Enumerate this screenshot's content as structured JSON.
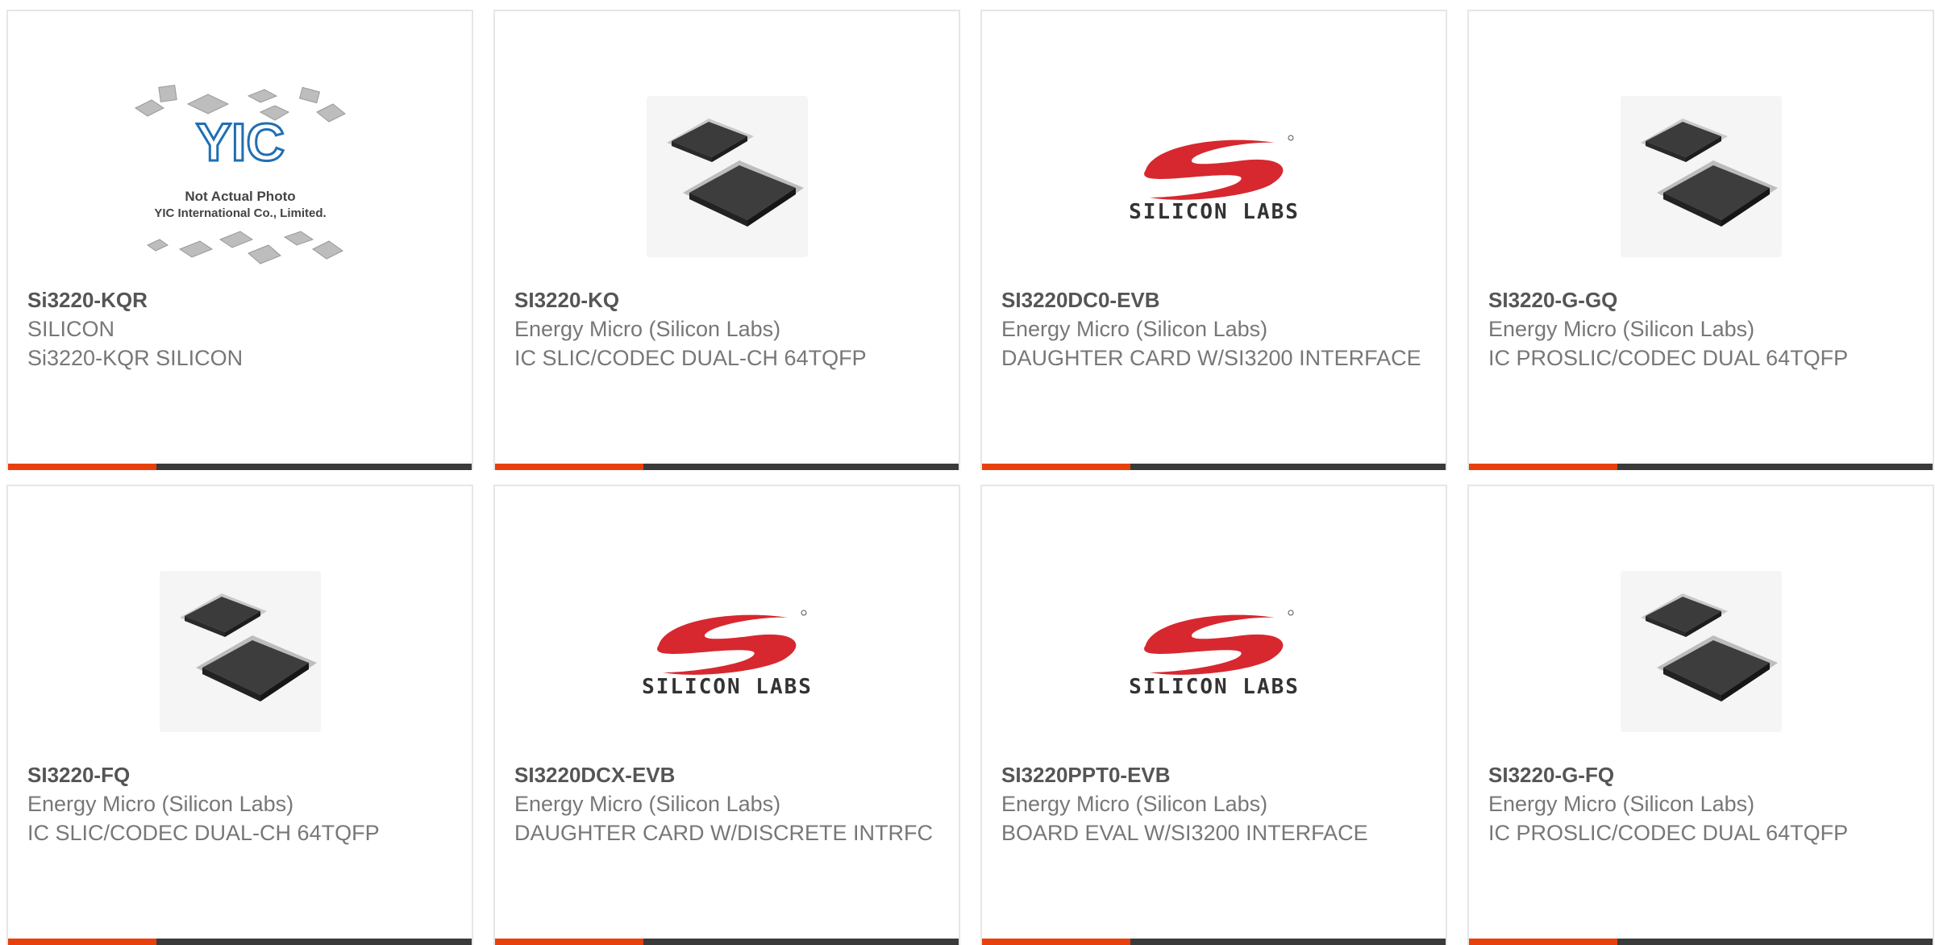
{
  "products": [
    {
      "part": "Si3220-KQR",
      "manufacturer": "SILICON",
      "description": "Si3220-KQR SILICON",
      "image": "not-actual-photo",
      "placeholder": {
        "line1": "Not Actual Photo",
        "line2": "YIC International Co., Limited.",
        "brand": "YIC"
      }
    },
    {
      "part": "SI3220-KQ",
      "manufacturer": "Energy Micro (Silicon Labs)",
      "description": "IC SLIC/CODEC DUAL-CH 64TQFP",
      "image": "chip-photo"
    },
    {
      "part": "SI3220DC0-EVB",
      "manufacturer": "Energy Micro (Silicon Labs)",
      "description": "DAUGHTER CARD W/SI3200 INTERFACE",
      "image": "silicon-labs-logo"
    },
    {
      "part": "SI3220-G-GQ",
      "manufacturer": "Energy Micro (Silicon Labs)",
      "description": "IC PROSLIC/CODEC DUAL 64TQFP",
      "image": "chip-photo"
    },
    {
      "part": "SI3220-FQ",
      "manufacturer": "Energy Micro (Silicon Labs)",
      "description": "IC SLIC/CODEC DUAL-CH 64TQFP",
      "image": "chip-photo"
    },
    {
      "part": "SI3220DCX-EVB",
      "manufacturer": "Energy Micro (Silicon Labs)",
      "description": "DAUGHTER CARD W/DISCRETE INTRFC",
      "image": "silicon-labs-logo"
    },
    {
      "part": "SI3220PPT0-EVB",
      "manufacturer": "Energy Micro (Silicon Labs)",
      "description": "BOARD EVAL W/SI3200 INTERFACE",
      "image": "silicon-labs-logo"
    },
    {
      "part": "SI3220-G-FQ",
      "manufacturer": "Energy Micro (Silicon Labs)",
      "description": "IC PROSLIC/CODEC DUAL 64TQFP",
      "image": "chip-photo"
    }
  ],
  "logo_text": "SILICON LABS",
  "colors": {
    "accent": "#e8400c",
    "bar": "#3a3a3a",
    "logo_red": "#d7282f"
  }
}
